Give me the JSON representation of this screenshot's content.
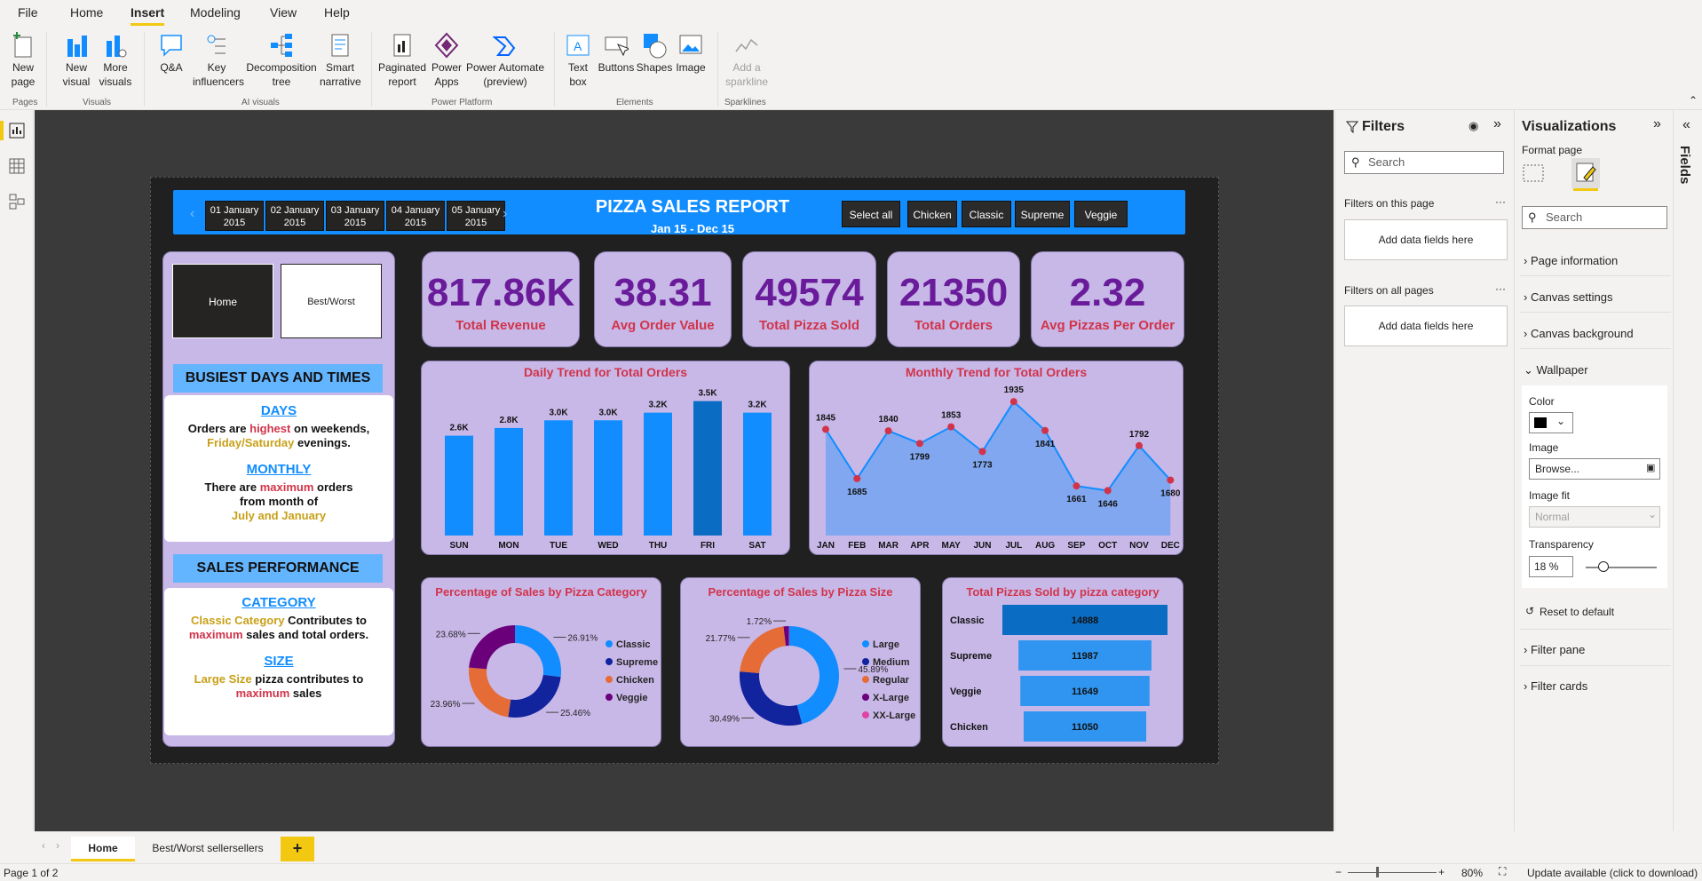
{
  "menu": [
    "File",
    "Home",
    "Insert",
    "Modeling",
    "View",
    "Help"
  ],
  "ribbon": {
    "buttons": [
      "New page",
      "New visual",
      "More visuals",
      "Q&A",
      "Key influencers",
      "Decomposition tree",
      "Smart narrative",
      "Paginated report",
      "Power Apps",
      "Power Automate (preview)",
      "Text box",
      "Buttons",
      "Shapes",
      "Image",
      "Add a sparkline"
    ],
    "groups": [
      "Pages",
      "Visuals",
      "AI visuals",
      "Power Platform",
      "Elements",
      "Sparklines"
    ]
  },
  "report": {
    "title": "PIZZA SALES REPORT",
    "subtitle": "Jan 15 - Dec 15",
    "dates": [
      [
        "01 January",
        "2015"
      ],
      [
        "02 January",
        "2015"
      ],
      [
        "03 January",
        "2015"
      ],
      [
        "04 January",
        "2015"
      ],
      [
        "05 January",
        "2015"
      ]
    ],
    "categories": [
      "Select all",
      "Chicken",
      "Classic",
      "Supreme",
      "Veggie"
    ],
    "nav": {
      "home": "Home",
      "best": "Best/Worst sellersellers"
    },
    "busiest": "BUSIEST DAYS AND TIMES",
    "days_head": "DAYS",
    "days_l1a": "Orders are ",
    "days_l1b": "highest",
    "days_l1c": " on  weekends,",
    "days_l2a": "Friday/Saturday",
    "days_l2b": " evenings.",
    "monthly_head": "MONTHLY",
    "mon_l1a": "There are ",
    "mon_l1b": "maximum",
    "mon_l1c": " orders",
    "mon_l2": "from month of",
    "mon_l3": "July and January",
    "sales_perf": "SALES PERFORMANCE",
    "cat_head": "CATEGORY",
    "cat_l1a": "Classic Category",
    "cat_l1b": " Contributes to",
    "cat_l2a": "maximum",
    "cat_l2b": " sales and total orders.",
    "size_head": "SIZE",
    "size_l1a": "Large Size",
    "size_l1b": " pizza contributes to",
    "size_l2": "maximum",
    "size_l2b": " sales",
    "kpis": [
      [
        "817.86K",
        "Total Revenue"
      ],
      [
        "38.31",
        "Avg Order Value"
      ],
      [
        "49574",
        "Total Pizza Sold"
      ],
      [
        "21350",
        "Total Orders"
      ],
      [
        "2.32",
        "Avg Pizzas Per Order"
      ]
    ]
  },
  "chart_data": [
    {
      "type": "bar",
      "title": "Daily Trend for Total Orders",
      "categories": [
        "SUN",
        "MON",
        "TUE",
        "WED",
        "THU",
        "FRI",
        "SAT"
      ],
      "values": [
        2.6,
        2.8,
        3.0,
        3.0,
        3.2,
        3.5,
        3.2
      ],
      "labels": [
        "2.6K",
        "2.8K",
        "3.0K",
        "3.0K",
        "3.2K",
        "3.5K",
        "3.2K"
      ],
      "color": "#118dff",
      "highlight": "#0b6cc4"
    },
    {
      "type": "area",
      "title": "Monthly Trend for Total Orders",
      "categories": [
        "JAN",
        "FEB",
        "MAR",
        "APR",
        "MAY",
        "JUN",
        "JUL",
        "AUG",
        "SEP",
        "OCT",
        "NOV",
        "DEC"
      ],
      "values": [
        1845,
        1685,
        1840,
        1799,
        1853,
        1773,
        1935,
        1841,
        1661,
        1646,
        1792,
        1680
      ]
    },
    {
      "type": "pie",
      "title": "Percentage of Sales by Pizza Category",
      "slices": [
        {
          "name": "Classic",
          "value": 26.91,
          "color": "#118dff",
          "label": "26.91%"
        },
        {
          "name": "Supreme",
          "value": 25.46,
          "color": "#12239e",
          "label": "25.46%"
        },
        {
          "name": "Chicken",
          "value": 23.96,
          "color": "#e66c37",
          "label": "23.96%"
        },
        {
          "name": "Veggie",
          "value": 23.68,
          "color": "#6b007b",
          "label": "23.68%"
        }
      ]
    },
    {
      "type": "pie",
      "title": "Percentage of Sales by Pizza Size",
      "slices": [
        {
          "name": "Large",
          "value": 45.89,
          "color": "#118dff",
          "label": "45.89%"
        },
        {
          "name": "Medium",
          "value": 30.49,
          "color": "#12239e",
          "label": "30.49%"
        },
        {
          "name": "Regular",
          "value": 21.77,
          "color": "#e66c37",
          "label": "21.77%"
        },
        {
          "name": "X-Large",
          "value": 1.72,
          "color": "#6b007b",
          "label": "1.72%"
        },
        {
          "name": "XX-Large",
          "value": 0.13,
          "color": "#e044a7",
          "label": ""
        }
      ]
    },
    {
      "type": "bar",
      "title": "Total Pizzas Sold by pizza category",
      "categories": [
        "Classic",
        "Supreme",
        "Veggie",
        "Chicken"
      ],
      "values": [
        14888,
        11987,
        11649,
        11050
      ]
    }
  ],
  "filters": {
    "title": "Filters",
    "search": "Search",
    "on_page": "Filters on this page",
    "on_all": "Filters on all pages",
    "add": "Add data fields here"
  },
  "viz": {
    "title": "Visualizations",
    "format_page": "Format page",
    "search": "Search",
    "sections": [
      "Page information",
      "Canvas settings",
      "Canvas background",
      "Wallpaper"
    ],
    "color": "Color",
    "image": "Image",
    "browse": "Browse...",
    "image_fit": "Image fit",
    "fit_value": "Normal",
    "transparency": "Transparency",
    "transparency_value": "18",
    "percent": "%",
    "reset": "Reset to default",
    "more_sections": [
      "Filter pane",
      "Filter cards"
    ]
  },
  "fields": "Fields",
  "tabs": [
    "Home",
    "Best/Worst sellersellers"
  ],
  "status": {
    "page": "Page 1 of 2",
    "zoom": "80%",
    "update": "Update available (click to download)"
  }
}
